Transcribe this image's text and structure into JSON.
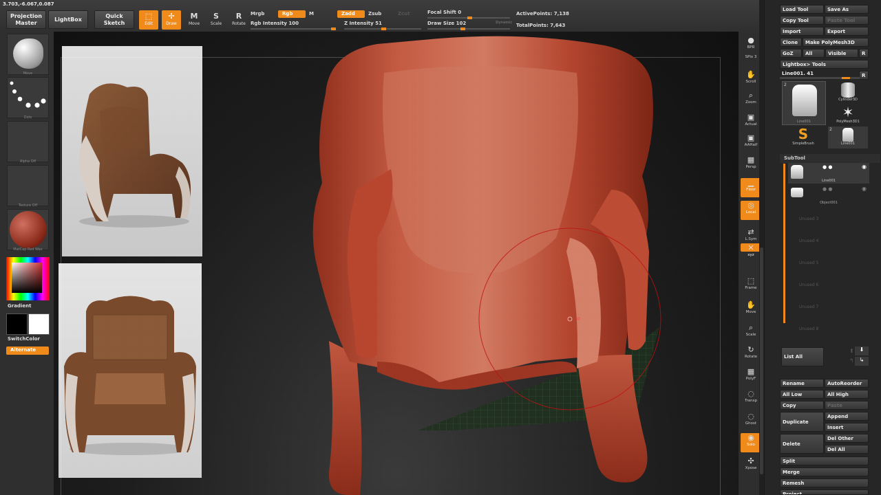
{
  "coords": "3.703,-6.067,0.087",
  "top": {
    "projection_master": "Projection Master",
    "lightbox": "LightBox",
    "quick_sketch": "Quick Sketch",
    "tools": [
      {
        "label": "Edit",
        "icon": "edit-icon",
        "on": true
      },
      {
        "label": "Draw",
        "icon": "draw-icon",
        "on": true
      },
      {
        "label": "Move",
        "icon": "move-icon",
        "on": false
      },
      {
        "label": "Scale",
        "icon": "scale-icon",
        "on": false
      },
      {
        "label": "Rotate",
        "icon": "rotate-icon",
        "on": false
      }
    ],
    "mrgb": "Mrgb",
    "rgb": "Rgb",
    "m": "M",
    "rgb_intensity": "Rgb Intensity 100",
    "zadd": "Zadd",
    "zsub": "Zsub",
    "zcut": "Zcut",
    "z_intensity": "Z Intensity 51",
    "focal_shift": "Focal Shift 0",
    "draw_size": "Draw Size 102",
    "dynamic": "Dynamic",
    "active_points": "ActivePoints: 7,138",
    "total_points": "TotalPoints: 7,643",
    "rgb_intensity_level": 1.0,
    "z_intensity_level": 0.51
  },
  "left": {
    "brush_caption": "Move",
    "stroke_caption": "Dots",
    "alpha_caption": "Alpha Off",
    "texture_caption": "Texture Off",
    "material_caption": "MatCap Red Wax",
    "gradient": "Gradient",
    "switch_color": "SwitchColor",
    "alternate": "Alternate"
  },
  "right_shelf": [
    {
      "label": "BPR",
      "icon": "bpr-icon",
      "on": false
    },
    {
      "label": "SPix 3",
      "icon": "",
      "on": false
    },
    {
      "label": "Scroll",
      "icon": "scroll-icon",
      "on": false
    },
    {
      "label": "Zoom",
      "icon": "zoom-icon",
      "on": false
    },
    {
      "label": "Actual",
      "icon": "actual-icon",
      "on": false
    },
    {
      "label": "AAHalf",
      "icon": "aahalf-icon",
      "on": false
    },
    {
      "label": "Persp",
      "icon": "persp-icon",
      "on": false
    },
    {
      "label": "Floor",
      "icon": "floor-icon",
      "on": true
    },
    {
      "label": "Local",
      "icon": "local-icon",
      "on": true
    },
    {
      "label": "L.Sym",
      "icon": "lsym-icon",
      "on": false
    },
    {
      "label": "xyz",
      "icon": "xyz-icon",
      "on": true
    },
    {
      "label": "Frame",
      "icon": "frame-icon",
      "on": false
    },
    {
      "label": "Move",
      "icon": "move-icon",
      "on": false
    },
    {
      "label": "Scale",
      "icon": "scale-icon",
      "on": false
    },
    {
      "label": "Rotate",
      "icon": "rotate-icon",
      "on": false
    },
    {
      "label": "PolyF",
      "icon": "polyf-icon",
      "on": false
    },
    {
      "label": "Transp",
      "icon": "transp-icon",
      "on": false
    },
    {
      "label": "Ghost",
      "icon": "ghost-icon",
      "on": false
    },
    {
      "label": "Solo",
      "icon": "solo-icon",
      "on": true
    },
    {
      "label": "Xpose",
      "icon": "xpose-icon",
      "on": false
    }
  ],
  "palette": {
    "load_tool": "Load Tool",
    "save_as": "Save As",
    "copy_tool": "Copy Tool",
    "paste_tool": "Paste Tool",
    "import": "Import",
    "export": "Export",
    "clone": "Clone",
    "make_polymesh": "Make PolyMesh3D",
    "goz": "GoZ",
    "all": "All",
    "visible": "Visible",
    "r": "R",
    "lightbox_tools": "Lightbox> Tools",
    "current_tool": "Line001. 41",
    "tool_items": [
      {
        "name": "Line001",
        "count": "2"
      },
      {
        "name": "Cylinder3D",
        "count": ""
      },
      {
        "name": "PolyMesh3D1",
        "count": ""
      },
      {
        "name": "SimpleBrush",
        "count": ""
      },
      {
        "name": "Line001",
        "count": "2"
      }
    ],
    "subtool": "SubTool",
    "subtools": [
      "Line001",
      "Object001"
    ],
    "unused": [
      "Unused 3",
      "Unused 4",
      "Unused 5",
      "Unused 6",
      "Unused 7",
      "Unused 8"
    ],
    "list_all": "List All",
    "rename": "Rename",
    "auto_reorder": "AutoReorder",
    "all_low": "All Low",
    "all_high": "All High",
    "copy": "Copy",
    "paste": "Paste",
    "duplicate": "Duplicate",
    "append": "Append",
    "insert": "Insert",
    "delete": "Delete",
    "del_other": "Del Other",
    "del_all": "Del All",
    "split": "Split",
    "merge": "Merge",
    "remesh": "Remesh",
    "project": "Project"
  },
  "colors": {
    "accent": "#f08a1a",
    "clay": "#b8452e",
    "chair_leather": "#7a4a2c"
  }
}
